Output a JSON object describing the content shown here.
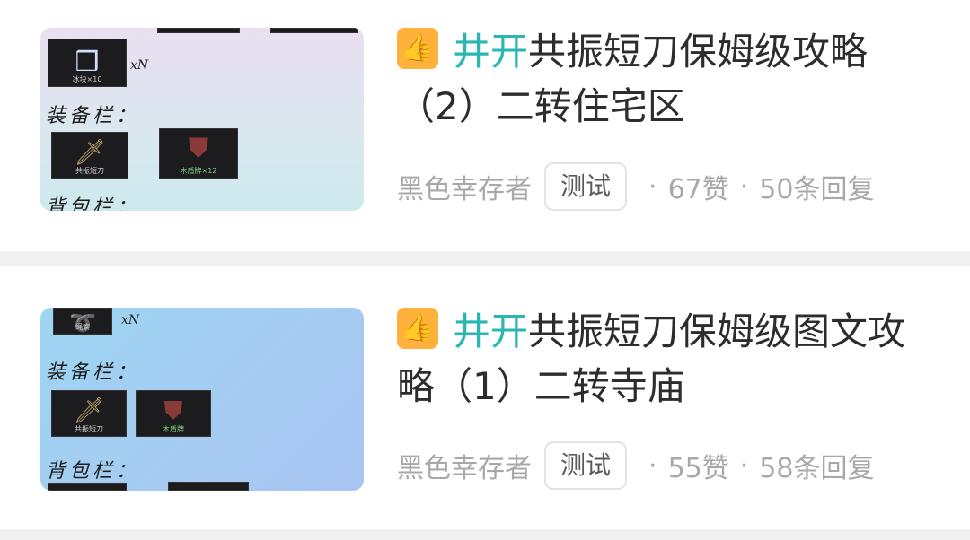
{
  "posts": [
    {
      "title_highlight": "井开",
      "title_rest": "共振短刀保姆级攻略（2）二转住宅区",
      "author": "黑色幸存者",
      "tag": "测试",
      "likes": "67赞",
      "replies": "50条回复",
      "thumb": {
        "label_equip": "装备栏：",
        "label_bag": "背包栏：",
        "xn": "xN",
        "slot_ice_caption": "冰块×10",
        "slot_knife_caption": "共振短刀",
        "slot_shield_caption": "木盾牌×12"
      }
    },
    {
      "title_highlight": "井开",
      "title_rest": "共振短刀保姆级图文攻略（1）二转寺庙",
      "author": "黑色幸存者",
      "tag": "测试",
      "likes": "55赞",
      "replies": "58条回复",
      "thumb": {
        "label_equip": "装备栏：",
        "label_bag": "背包栏：",
        "xn": "xN",
        "slot_rope_caption": "绳索",
        "slot_knife_caption": "共振短刀",
        "slot_shield_caption": "木盾牌"
      }
    }
  ],
  "icons": {
    "like_icon": "thumbs-up-icon",
    "separator": "·"
  },
  "colors": {
    "accent": "#2ab7b2",
    "like_badge": "#ffb13b",
    "meta_text": "#a8a8a8"
  }
}
